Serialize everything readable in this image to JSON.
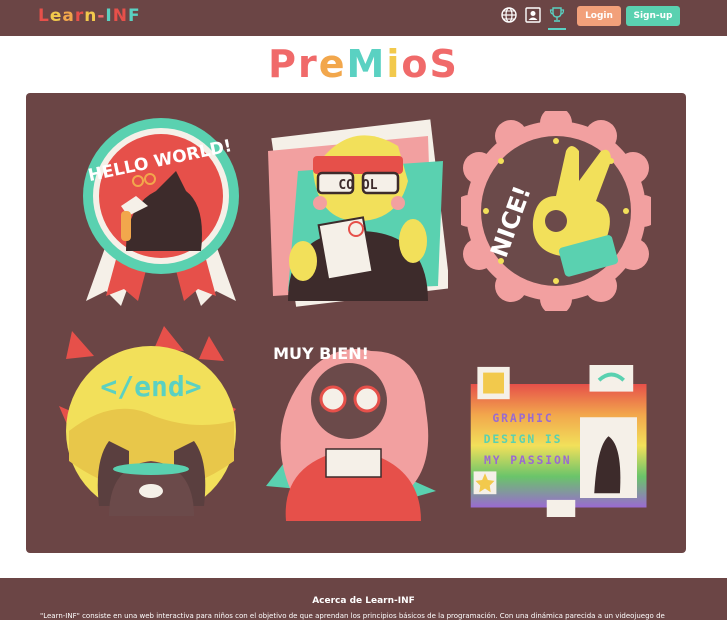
{
  "header": {
    "logo_letters": [
      "L",
      "e",
      "a",
      "r",
      "n",
      "-",
      "I",
      "N",
      "F"
    ],
    "logo_colors": [
      "#e6504a",
      "#f2c94c",
      "#f2a74c",
      "#e6504a",
      "#f2c94c",
      "#f06a6a",
      "#5ad1c2",
      "#e6504a",
      "#5ad1c2"
    ],
    "nav_icons": [
      "globe-icon",
      "profile-icon",
      "trophy-icon"
    ],
    "login_label": "Login",
    "signup_label": "Sign-up",
    "login_color": "#f2a07a",
    "signup_color": "#5ad1b0"
  },
  "page": {
    "title_letters": [
      "P",
      "r",
      "e",
      "M",
      "i",
      "o",
      "S"
    ],
    "title_colors": [
      "#f06a6a",
      "#f06a6a",
      "#f2a74c",
      "#5ad1c2",
      "#f2c94c",
      "#f06a6a",
      "#f06a6a"
    ]
  },
  "badges": [
    {
      "name": "hello-world-badge",
      "text": "HELLO WORLD!"
    },
    {
      "name": "cool-badge",
      "text": "CO  OL"
    },
    {
      "name": "nice-badge",
      "text": "NICE!"
    },
    {
      "name": "end-badge",
      "text": "</end>"
    },
    {
      "name": "muy-bien-badge",
      "text": "MUY BIEN!"
    },
    {
      "name": "graphic-design-badge",
      "lines": [
        "GRAPHIC",
        "DESIGN IS",
        "MY PASSION"
      ]
    }
  ],
  "footer": {
    "title": "Acerca de Learn-INF",
    "text": "\"Learn-INF\" consiste en una web interactiva para niños con el objetivo de que aprendan los principios básicos de la programación. Con una dinámica parecida a un videojuego de"
  }
}
